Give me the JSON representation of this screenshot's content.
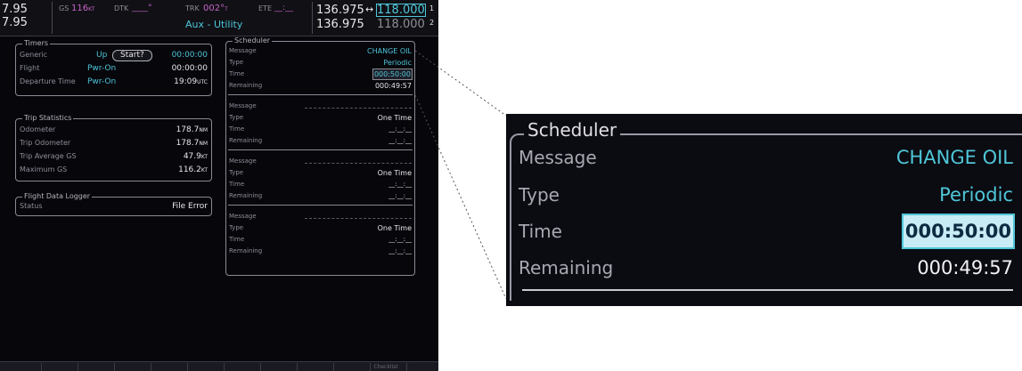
{
  "top_bar": {
    "left_freq_1": "7.95",
    "left_freq_2": "7.95",
    "gs_label": "GS",
    "gs_value": "116",
    "gs_unit": "KT",
    "dtk_label": "DTK",
    "dtk_value": "____°",
    "trk_label": "TRK",
    "trk_value": "002°",
    "trk_suffix": "T",
    "ete_label": "ETE",
    "ete_value": "__:__",
    "page_title": "Aux - Utility",
    "com_active_1": "136.975",
    "com_arrow": "↔",
    "com_standby_1": "118.000",
    "com_active_2": "136.975",
    "com_standby_2": "118.000",
    "com_index_1": "1",
    "com_index_2": "2"
  },
  "timers": {
    "title": "Timers",
    "rows": [
      {
        "label": "Generic",
        "dir": "Up",
        "button": "Start?",
        "time": "00:00:00",
        "unit": ""
      },
      {
        "label": "Flight",
        "mode": "Pwr-On",
        "time": "00:00:00",
        "unit": ""
      },
      {
        "label": "Departure Time",
        "mode": "Pwr-On",
        "time": "19:09",
        "unit": "UTC"
      }
    ]
  },
  "trip_statistics": {
    "title": "Trip Statistics",
    "rows": [
      {
        "label": "Odometer",
        "value": "178.7",
        "unit": "NM"
      },
      {
        "label": "Trip Odometer",
        "value": "178.7",
        "unit": "NM"
      },
      {
        "label": "Trip Average GS",
        "value": "47.9",
        "unit": "KT"
      },
      {
        "label": "Maximum GS",
        "value": "116.2",
        "unit": "KT"
      }
    ]
  },
  "flight_data_logger": {
    "title": "Flight Data Logger",
    "status_label": "Status",
    "status_value": "File Error"
  },
  "scheduler": {
    "title": "Scheduler",
    "labels": {
      "message": "Message",
      "type": "Type",
      "time": "Time",
      "remaining": "Remaining"
    },
    "entries": [
      {
        "message": "CHANGE OIL",
        "type": "Periodic",
        "time": "000:50:00",
        "remaining": "000:49:57"
      },
      {
        "message": "",
        "type": "One Time",
        "time": "__:__:__",
        "remaining": "__:__:__"
      },
      {
        "message": "",
        "type": "One Time",
        "time": "__:__:__",
        "remaining": "__:__:__"
      },
      {
        "message": "",
        "type": "One Time",
        "time": "__:__:__",
        "remaining": "__:__:__"
      }
    ]
  },
  "softkeys": {
    "checklist_label": "Checklist"
  },
  "zoom": {
    "title": "Scheduler",
    "message_label": "Message",
    "message_value": "CHANGE OIL",
    "type_label": "Type",
    "type_value": "Periodic",
    "time_label": "Time",
    "time_value": "000:50:00",
    "remaining_label": "Remaining",
    "remaining_value": "000:49:57"
  }
}
